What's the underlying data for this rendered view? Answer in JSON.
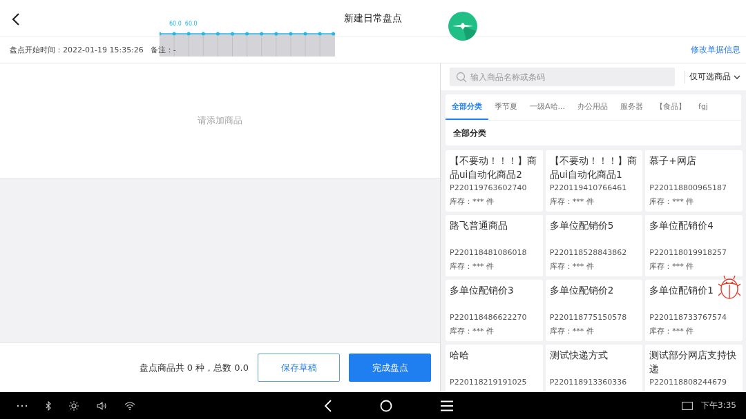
{
  "header": {
    "title": "新建日常盘点"
  },
  "overlay": {
    "labels": [
      "60.0",
      "60.0"
    ]
  },
  "info_bar": {
    "start_time": "盘点开始时间：2022-01-19 15:35:26",
    "remark": "备注：-",
    "edit_link": "修改单据信息"
  },
  "list": {
    "empty_message": "请添加商品"
  },
  "footer": {
    "summary": "盘点商品共 0 种，总数 0.0",
    "buttons": [
      {
        "label": "保存草稿",
        "kind": "outline"
      },
      {
        "label": "完成盘点",
        "kind": "primary"
      }
    ]
  },
  "search": {
    "placeholder": "输入商品名称或条码",
    "filter": "仅可选商品"
  },
  "tabs": [
    {
      "label": "全部分类",
      "selected": true
    },
    {
      "label": "季节夏",
      "selected": false
    },
    {
      "label": "一级A哈...",
      "selected": false
    },
    {
      "label": "办公用品",
      "selected": false
    },
    {
      "label": "服务器",
      "selected": false
    },
    {
      "label": "【食品】",
      "selected": false
    },
    {
      "label": "fgj",
      "selected": false
    }
  ],
  "category_heading": "全部分类",
  "products": [
    {
      "name": "【不要动！！！】商品ui自动化商品2",
      "code": "P220119763602740",
      "stock": "库存：*** 件"
    },
    {
      "name": "【不要动！！！】商品ui自动化商品1",
      "code": "P220119410766461",
      "stock": "库存：*** 件"
    },
    {
      "name": "慕子+网店",
      "code": "P220118800965187",
      "stock": "库存：*** 件"
    },
    {
      "name": "路飞普通商品",
      "code": "P220118481086018",
      "stock": "库存：*** 件"
    },
    {
      "name": "多单位配销价5",
      "code": "P220118528843862",
      "stock": "库存：*** 件"
    },
    {
      "name": "多单位配销价4",
      "code": "P220118019918257",
      "stock": "库存：*** 件"
    },
    {
      "name": "多单位配销价3",
      "code": "P220118486622270",
      "stock": "库存：*** 件"
    },
    {
      "name": "多单位配销价2",
      "code": "P220118775150578",
      "stock": "库存：*** 件"
    },
    {
      "name": "多单位配销价1",
      "code": "P220118733767574",
      "stock": "库存：*** 件"
    },
    {
      "name": "哈哈",
      "code": "P220118219191025"
    },
    {
      "name": "测试快递方式",
      "code": "P220118913360336"
    },
    {
      "name": "测试部分网店支持快递",
      "code": "P220118808244679"
    }
  ],
  "nav_bar": {
    "time": "下午3:35"
  }
}
